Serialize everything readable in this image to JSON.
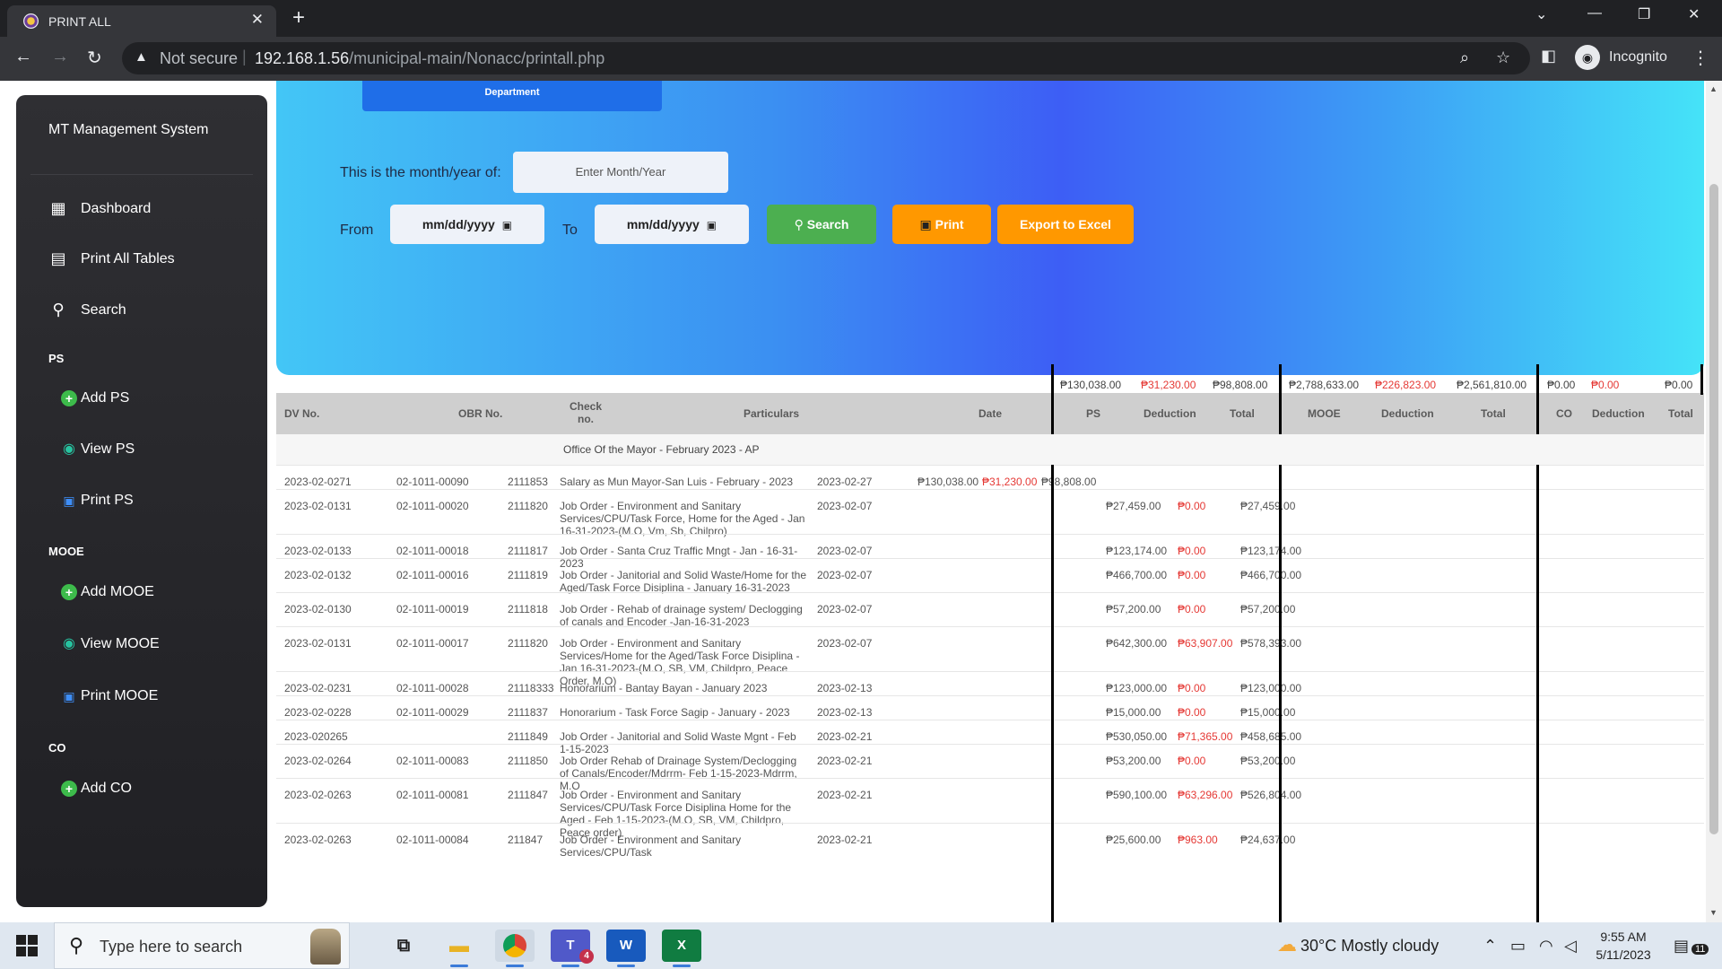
{
  "browser": {
    "tab_title": "PRINT ALL",
    "tab_close": "✕",
    "new_tab": "+",
    "not_secure": "Not secure",
    "url_host": "192.168.1.56",
    "url_path": "/municipal-main/Nonacc/printall.php",
    "profile_label": "Incognito"
  },
  "sidebar": {
    "brand": "MT Management System",
    "nav": [
      {
        "label": "Dashboard",
        "icon": "dashboard-icon"
      },
      {
        "label": "Print All Tables",
        "icon": "document-icon"
      },
      {
        "label": "Search",
        "icon": "search-icon"
      }
    ],
    "sections": [
      {
        "heading": "PS",
        "items": [
          {
            "label": "Add PS",
            "icon": "plus-circle-icon"
          },
          {
            "label": "View PS",
            "icon": "eye-icon"
          },
          {
            "label": "Print PS",
            "icon": "printer-icon"
          }
        ]
      },
      {
        "heading": "MOOE",
        "items": [
          {
            "label": "Add MOOE",
            "icon": "plus-circle-icon"
          },
          {
            "label": "View MOOE",
            "icon": "eye-icon"
          },
          {
            "label": "Print MOOE",
            "icon": "printer-icon"
          }
        ]
      },
      {
        "heading": "CO",
        "items": [
          {
            "label": "Add CO",
            "icon": "plus-circle-icon"
          }
        ]
      }
    ]
  },
  "filters": {
    "department_label": "Department",
    "month_label": "This is the month/year of:",
    "month_placeholder": "Enter Month/Year",
    "from_label": "From",
    "to_label": "To",
    "from_value": "mm/dd/yyyy",
    "to_value": "mm/dd/yyyy",
    "search_label": "Search",
    "print_label": "Print",
    "export_label": "Export to Excel"
  },
  "totals": {
    "ps": "₱130,038.00",
    "ps_deduction": "₱31,230.00",
    "ps_total": "₱98,808.00",
    "mooe": "₱2,788,633.00",
    "mooe_deduction": "₱226,823.00",
    "mooe_total": "₱2,561,810.00",
    "co": "₱0.00",
    "co_deduction": "₱0.00",
    "co_total": "₱0.00"
  },
  "table": {
    "headers": {
      "dv": "DV No.",
      "obr": "OBR No.",
      "check": "Check no.",
      "particulars": "Particulars",
      "date": "Date",
      "ps": "PS",
      "ps_deduction": "Deduction",
      "ps_total": "Total",
      "mooe": "MOOE",
      "mooe_deduction": "Deduction",
      "mooe_total": "Total",
      "co": "CO",
      "co_deduction": "Deduction",
      "co_total": "Total"
    },
    "group": "Office Of the Mayor - February 2023 - AP",
    "rows": [
      {
        "dv": "2023-02-0271",
        "obr": "02-1011-00090",
        "check": "2111853",
        "particulars": "Salary as Mun Mayor-San Luis - February - 2023",
        "date": "2023-02-27",
        "ps": "₱130,038.00",
        "ps_ded": "₱31,230.00",
        "ps_tot": "₱98,808.00",
        "mooe": "",
        "mooe_ded": "",
        "mooe_tot": ""
      },
      {
        "dv": "2023-02-0131",
        "obr": "02-1011-00020",
        "check": "2111820",
        "particulars": "Job Order - Environment and Sanitary Services/CPU/Task Force, Home for the Aged - Jan 16-31-2023-(M.O, Vm, Sb, Chilpro)",
        "date": "2023-02-07",
        "ps": "",
        "ps_ded": "",
        "ps_tot": "",
        "mooe": "₱27,459.00",
        "mooe_ded": "₱0.00",
        "mooe_tot": "₱27,459.00"
      },
      {
        "dv": "2023-02-0133",
        "obr": "02-1011-00018",
        "check": "2111817",
        "particulars": "Job Order - Santa Cruz Traffic Mngt - Jan - 16-31-2023",
        "date": "2023-02-07",
        "ps": "",
        "ps_ded": "",
        "ps_tot": "",
        "mooe": "₱123,174.00",
        "mooe_ded": "₱0.00",
        "mooe_tot": "₱123,174.00"
      },
      {
        "dv": "2023-02-0132",
        "obr": "02-1011-00016",
        "check": "2111819",
        "particulars": "Job Order - Janitorial and Solid Waste/Home for the Aged/Task Force Disiplina - January 16-31-2023",
        "date": "2023-02-07",
        "ps": "",
        "ps_ded": "",
        "ps_tot": "",
        "mooe": "₱466,700.00",
        "mooe_ded": "₱0.00",
        "mooe_tot": "₱466,700.00"
      },
      {
        "dv": "2023-02-0130",
        "obr": "02-1011-00019",
        "check": "2111818",
        "particulars": "Job Order - Rehab of drainage system/ Declogging of canals and Encoder -Jan-16-31-2023",
        "date": "2023-02-07",
        "ps": "",
        "ps_ded": "",
        "ps_tot": "",
        "mooe": "₱57,200.00",
        "mooe_ded": "₱0.00",
        "mooe_tot": "₱57,200.00"
      },
      {
        "dv": "2023-02-0131",
        "obr": "02-1011-00017",
        "check": "2111820",
        "particulars": "Job Order - Environment and Sanitary Services/Home for the Aged/Task Force Disiplina - Jan 16-31-2023-(M.O, SB, VM, Childpro, Peace Order, M.O)",
        "date": "2023-02-07",
        "ps": "",
        "ps_ded": "",
        "ps_tot": "",
        "mooe": "₱642,300.00",
        "mooe_ded": "₱63,907.00",
        "mooe_tot": "₱578,393.00"
      },
      {
        "dv": "2023-02-0231",
        "obr": "02-1011-00028",
        "check": "21118333",
        "particulars": "Honorarium - Bantay Bayan - January 2023",
        "date": "2023-02-13",
        "ps": "",
        "ps_ded": "",
        "ps_tot": "",
        "mooe": "₱123,000.00",
        "mooe_ded": "₱0.00",
        "mooe_tot": "₱123,000.00"
      },
      {
        "dv": "2023-02-0228",
        "obr": "02-1011-00029",
        "check": "2111837",
        "particulars": "Honorarium - Task Force Sagip - January - 2023",
        "date": "2023-02-13",
        "ps": "",
        "ps_ded": "",
        "ps_tot": "",
        "mooe": "₱15,000.00",
        "mooe_ded": "₱0.00",
        "mooe_tot": "₱15,000.00"
      },
      {
        "dv": "2023-020265",
        "obr": "",
        "check": "2111849",
        "particulars": "Job Order - Janitorial and Solid Waste Mgnt - Feb 1-15-2023",
        "date": "2023-02-21",
        "ps": "",
        "ps_ded": "",
        "ps_tot": "",
        "mooe": "₱530,050.00",
        "mooe_ded": "₱71,365.00",
        "mooe_tot": "₱458,685.00"
      },
      {
        "dv": "2023-02-0264",
        "obr": "02-1011-00083",
        "check": "2111850",
        "particulars": "Job Order Rehab of Drainage System/Declogging of Canals/Encoder/Mdrrm- Feb 1-15-2023-Mdrrm, M.O",
        "date": "2023-02-21",
        "ps": "",
        "ps_ded": "",
        "ps_tot": "",
        "mooe": "₱53,200.00",
        "mooe_ded": "₱0.00",
        "mooe_tot": "₱53,200.00"
      },
      {
        "dv": "2023-02-0263",
        "obr": "02-1011-00081",
        "check": "2111847",
        "particulars": "Job Order - Environment and Sanitary Services/CPU/Task Force Disiplina Home for the Aged - Feb 1-15-2023-(M.O, SB, VM, Childpro, Peace order)",
        "date": "2023-02-21",
        "ps": "",
        "ps_ded": "",
        "ps_tot": "",
        "mooe": "₱590,100.00",
        "mooe_ded": "₱63,296.00",
        "mooe_tot": "₱526,804.00"
      },
      {
        "dv": "2023-02-0263",
        "obr": "02-1011-00084",
        "check": "211847",
        "particulars": "Job Order - Environment and Sanitary Services/CPU/Task",
        "date": "2023-02-21",
        "ps": "",
        "ps_ded": "",
        "ps_tot": "",
        "mooe": "₱25,600.00",
        "mooe_ded": "₱963.00",
        "mooe_tot": "₱24,637.00"
      }
    ]
  },
  "taskbar": {
    "search_placeholder": "Type here to search",
    "weather": "30°C  Mostly cloudy",
    "time": "9:55 AM",
    "date": "5/11/2023",
    "notifications": "11",
    "teams_badge": "4"
  },
  "colors": {
    "deduction": "#e53935",
    "search_button": "#4caf50",
    "print_button": "#ff9800",
    "department_button": "#1f6ee8"
  }
}
